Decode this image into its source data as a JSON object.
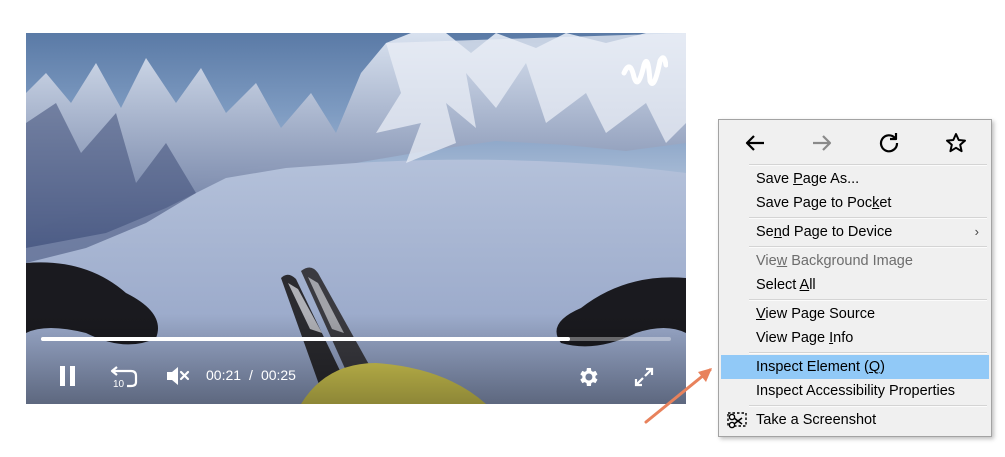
{
  "player": {
    "current_time": "00:21",
    "time_separator": "/",
    "duration": "00:25",
    "progress_fraction": 0.84,
    "icons": {
      "play_pause": "pause-icon",
      "rewind": "rewind-10-icon",
      "rewind_label": "10",
      "volume": "volume-muted-icon",
      "settings": "gear-icon",
      "fullscreen": "expand-icon",
      "watermark": "brand-logo-icon"
    }
  },
  "context_menu": {
    "nav": {
      "back": "back-arrow-icon",
      "forward": "forward-arrow-icon",
      "reload": "reload-icon",
      "bookmark": "star-icon"
    },
    "items": [
      {
        "pre": "Save ",
        "key": "P",
        "post": "age As..."
      },
      {
        "pre": "Save Page to Poc",
        "key": "k",
        "post": "et"
      },
      {
        "pre": "Se",
        "key": "n",
        "post": "d Page to Device",
        "submenu": "›"
      },
      {
        "pre": "Vie",
        "key": "w",
        "post": " Background Image",
        "disabled": true
      },
      {
        "pre": "Select ",
        "key": "A",
        "post": "ll"
      },
      {
        "pre": "",
        "key": "V",
        "post": "iew Page Source"
      },
      {
        "pre": "View Page ",
        "key": "I",
        "post": "nfo"
      },
      {
        "pre": "Inspect Element (",
        "key": "Q",
        "post": ")",
        "highlighted": true
      },
      {
        "pre": "Inspect Accessibility Properties",
        "key": "",
        "post": ""
      },
      {
        "pre": "Take a Screenshot",
        "key": "",
        "post": "",
        "icon": "screenshot-scissors-icon"
      }
    ]
  },
  "colors": {
    "menu_bg": "#f0f0f0",
    "menu_highlight": "#91c9f7",
    "annotation_arrow": "#e8825c",
    "disabled_text": "#6d6d6d"
  }
}
